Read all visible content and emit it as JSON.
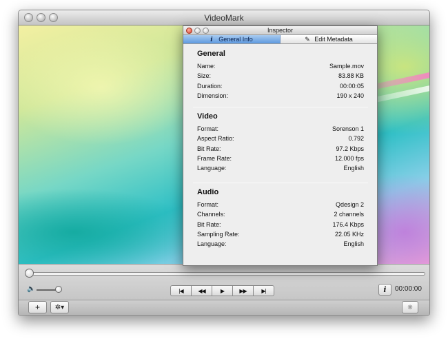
{
  "window": {
    "title": "VideoMark"
  },
  "controls": {
    "timecode": "00:00:00",
    "info_label": "i",
    "transport": [
      {
        "name": "skip-to-start-button",
        "glyph": "|◀"
      },
      {
        "name": "rewind-button",
        "glyph": "◀◀"
      },
      {
        "name": "play-button",
        "glyph": "▶"
      },
      {
        "name": "fast-forward-button",
        "glyph": "▶▶"
      },
      {
        "name": "skip-to-end-button",
        "glyph": "▶|"
      }
    ],
    "playback_position": 0,
    "volume_level": 0.8
  },
  "bottombar": {
    "add_label": "+",
    "action_label": "✲▾"
  },
  "inspector": {
    "title": "Inspector",
    "tabs": [
      {
        "label": "General Info",
        "icon": "info-icon",
        "selected": true
      },
      {
        "label": "Edit Metadata",
        "icon": "pencil-icon",
        "selected": false
      }
    ],
    "sections": [
      {
        "title": "General",
        "rows": [
          {
            "key": "Name:",
            "value": "Sample.mov"
          },
          {
            "key": "Size:",
            "value": "83.88 KB"
          },
          {
            "key": "Duration:",
            "value": "00:00:05"
          },
          {
            "key": "Dimension:",
            "value": "190 x 240"
          }
        ]
      },
      {
        "title": "Video",
        "rows": [
          {
            "key": "Format:",
            "value": "Sorenson 1"
          },
          {
            "key": "Aspect Ratio:",
            "value": "0.792"
          },
          {
            "key": "Bit Rate:",
            "value": "97.2 Kbps"
          },
          {
            "key": "Frame Rate:",
            "value": "12.000 fps"
          },
          {
            "key": "Language:",
            "value": "English"
          }
        ]
      },
      {
        "title": "Audio",
        "rows": [
          {
            "key": "Format:",
            "value": "Qdesign 2"
          },
          {
            "key": "Channels:",
            "value": "2 channels"
          },
          {
            "key": "Bit Rate:",
            "value": "176.4 Kbps"
          },
          {
            "key": "Sampling Rate:",
            "value": "22.05 KHz"
          },
          {
            "key": "Language:",
            "value": "English"
          }
        ]
      }
    ]
  }
}
